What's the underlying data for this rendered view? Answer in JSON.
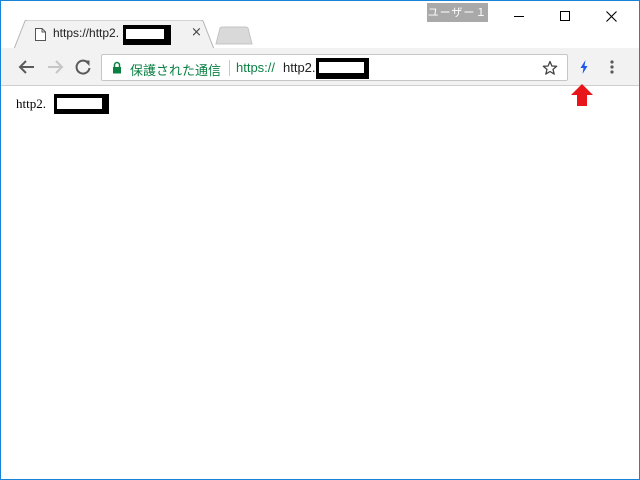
{
  "window": {
    "profile_label": "ユーザー１"
  },
  "tab": {
    "title": "https://http2.",
    "close_symbol": "×"
  },
  "toolbar": {
    "secure_label": "保護された通信",
    "url_scheme": "https://",
    "url_host": "http2."
  },
  "page": {
    "body_text": "http2."
  },
  "icons": {
    "back": "back-arrow-icon",
    "forward": "forward-arrow-icon",
    "reload": "reload-icon",
    "lock": "lock-icon",
    "star": "bookmark-star-icon",
    "extension": "lightning-bolt-icon",
    "menu": "kebab-menu-icon",
    "annotation": "red-up-arrow-icon"
  },
  "colors": {
    "window_border": "#1883d7",
    "secure_green": "#0b8043",
    "extension_blue": "#1a57e8",
    "annotation_red": "#e8151b",
    "profile_badge": "#a9a9a9"
  }
}
